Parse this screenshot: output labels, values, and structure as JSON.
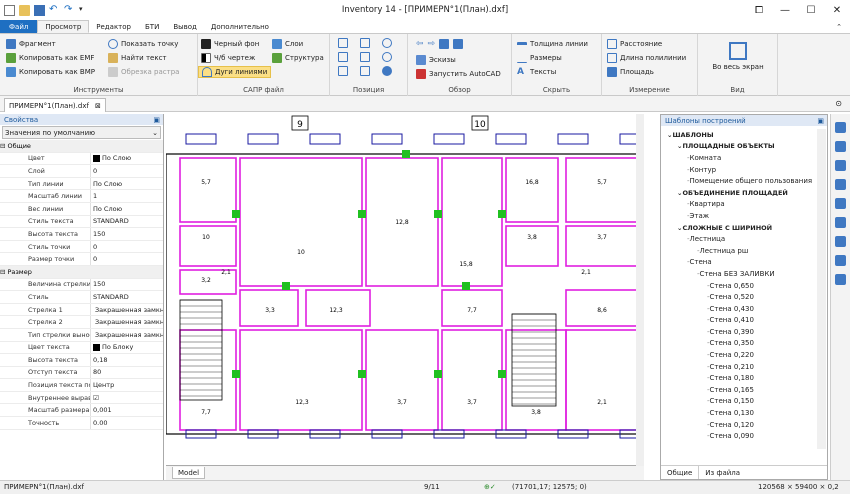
{
  "window": {
    "title": "Inventory 14 - [ПРИМЕРN°1(План).dxf]"
  },
  "tabs": [
    "Файл",
    "Просмотр",
    "Редактор",
    "БТИ",
    "Вывод",
    "Дополнительно"
  ],
  "ribbon": {
    "instruments": {
      "label": "Инструменты",
      "items": [
        "Фрагмент",
        "Копировать как EMF",
        "Копировать как BMP",
        "Показать точку",
        "Найти текст",
        "Обрезка растра"
      ]
    },
    "sapr": {
      "label": "САПР файл",
      "items": [
        "Черный фон",
        "Ч/б чертеж",
        "Дуги линиями",
        "Слои",
        "Структура"
      ]
    },
    "position": {
      "label": "Позиция"
    },
    "overview": {
      "label": "Обзор",
      "items": [
        "Эскизы",
        "Запустить AutoCAD"
      ]
    },
    "hide": {
      "label": "Скрыть",
      "items": [
        "Толщина линии",
        "Размеры",
        "Тексты"
      ]
    },
    "measure": {
      "label": "Измерение",
      "items": [
        "Расстояние",
        "Длина полилинии",
        "Площадь"
      ]
    },
    "view": {
      "label": "Вид",
      "items": [
        "Во весь экран"
      ]
    }
  },
  "doc_tab": "ПРИМЕРN°1(План).dxf",
  "properties": {
    "header": "Свойства",
    "preset": "Значения по умолчанию",
    "rows": [
      {
        "cat": true,
        "n": "Общие"
      },
      {
        "n": "Цвет",
        "v": "По Слою",
        "sw": "#000"
      },
      {
        "n": "Слой",
        "v": "0"
      },
      {
        "n": "Тип линии",
        "v": "По Слою"
      },
      {
        "n": "Масштаб линии",
        "v": "1"
      },
      {
        "n": "Вес линии",
        "v": "По Слою"
      },
      {
        "n": "Стиль текста",
        "v": "STANDARD"
      },
      {
        "n": "Высота текста",
        "v": "150"
      },
      {
        "n": "Стиль точки",
        "v": "0"
      },
      {
        "n": "Размер точки",
        "v": "0"
      },
      {
        "cat": true,
        "n": "Размер"
      },
      {
        "n": "Величина стрелки",
        "v": "150"
      },
      {
        "n": "Стиль",
        "v": "STANDARD"
      },
      {
        "n": "Стрелка 1",
        "v": "Закрашенная замкнутая",
        "sw": "#000"
      },
      {
        "n": "Стрелка 2",
        "v": "Закрашенная замкнутая",
        "sw": "#000"
      },
      {
        "n": "Тип стрелки выноски",
        "v": "Закрашенная замкнутая",
        "sw": "#000"
      },
      {
        "n": "Цвет текста",
        "v": "По Блоку",
        "sw": "#000"
      },
      {
        "n": "Высота текста",
        "v": "0,18"
      },
      {
        "n": "Отступ текста",
        "v": "80"
      },
      {
        "n": "Позиция текста по вертикали",
        "v": "Центр"
      },
      {
        "n": "Внутреннее выравнивание",
        "v": "☑"
      },
      {
        "n": "Масштаб размера",
        "v": "0,001"
      },
      {
        "n": "Точность",
        "v": "0.00"
      }
    ]
  },
  "model_tab": "Model",
  "templates": {
    "header": "Шаблоны построений",
    "tree": [
      {
        "t": "ШАБЛОНЫ",
        "b": true,
        "d": 0
      },
      {
        "t": "ПЛОЩАДНЫЕ ОБЪЕКТЫ",
        "b": true,
        "d": 1
      },
      {
        "t": "Комната",
        "d": 2
      },
      {
        "t": "Контур",
        "d": 2
      },
      {
        "t": "Помещение общего пользования",
        "d": 2
      },
      {
        "t": "ОБЪЕДИНЕНИЕ ПЛОЩАДЕЙ",
        "b": true,
        "d": 1
      },
      {
        "t": "Квартира",
        "d": 2
      },
      {
        "t": "Этаж",
        "d": 2
      },
      {
        "t": "СЛОЖНЫЕ С ШИРИНОЙ",
        "b": true,
        "d": 1
      },
      {
        "t": "Лестница",
        "d": 2
      },
      {
        "t": "Лестница рш",
        "d": 3
      },
      {
        "t": "Стена",
        "d": 2
      },
      {
        "t": "Стена БЕЗ ЗАЛИВКИ",
        "d": 3
      },
      {
        "t": "Стена 0,650",
        "d": 4
      },
      {
        "t": "Стена 0,520",
        "d": 4
      },
      {
        "t": "Стена 0,430",
        "d": 4
      },
      {
        "t": "Стена 0,410",
        "d": 4
      },
      {
        "t": "Стена 0,390",
        "d": 4
      },
      {
        "t": "Стена 0,350",
        "d": 4
      },
      {
        "t": "Стена 0,220",
        "d": 4
      },
      {
        "t": "Стена 0,210",
        "d": 4
      },
      {
        "t": "Стена 0,180",
        "d": 4
      },
      {
        "t": "Стена 0,165",
        "d": 4
      },
      {
        "t": "Стена 0,150",
        "d": 4
      },
      {
        "t": "Стена 0,130",
        "d": 4
      },
      {
        "t": "Стена 0,120",
        "d": 4
      },
      {
        "t": "Стена 0,090",
        "d": 4
      }
    ],
    "tabs": [
      "Общие",
      "Из файла"
    ]
  },
  "status": {
    "file": "ПРИМЕРN°1(План).dxf",
    "page": "9/11",
    "coords": "(71701,17; 12575; 0)",
    "extent": "120568 × 59400 × 0,2"
  },
  "drawing": {
    "axis_labels": [
      "9",
      "10"
    ],
    "rooms": [
      "5,7",
      "10",
      "12,8",
      "15,8",
      "16,8",
      "5,7",
      "10",
      "3,8",
      "3,7",
      "3,2",
      "3,3",
      "12,3",
      "7,7",
      "8,6",
      "7,7",
      "12,3",
      "3,7",
      "3,7",
      "3,8",
      "2,1",
      "2,1",
      "2,1"
    ]
  }
}
